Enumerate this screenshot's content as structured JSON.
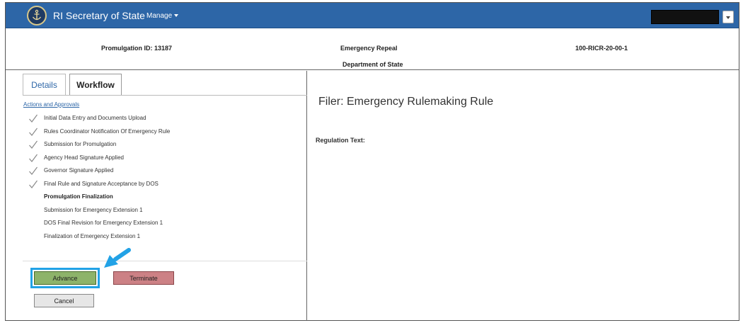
{
  "navbar": {
    "brand": "RI Secretary of State",
    "manage_label": "Manage",
    "accent": "#2d66a7"
  },
  "header": {
    "promulgation_id": "Promulgation ID: 13187",
    "type": "Emergency Repeal",
    "ricr": "100-RICR-20-00-1",
    "department": "Department of State"
  },
  "tabs": [
    {
      "label": "Details"
    },
    {
      "label": "Workflow"
    }
  ],
  "workflow": {
    "section_title": "Actions and Approvals",
    "steps": [
      {
        "label": "Initial Data Entry and Documents Upload",
        "status": "complete"
      },
      {
        "label": "Rules Coordinator Notification Of Emergency Rule",
        "status": "complete"
      },
      {
        "label": "Submission for Promulgation",
        "status": "complete"
      },
      {
        "label": "Agency Head Signature Applied",
        "status": "complete"
      },
      {
        "label": "Governor Signature Applied",
        "status": "complete"
      },
      {
        "label": "Final Rule and Signature Acceptance by DOS",
        "status": "complete"
      },
      {
        "label": "Promulgation Finalization",
        "status": "current"
      },
      {
        "label": "Submission for Emergency Extension 1",
        "status": "pending"
      },
      {
        "label": "DOS Final Revision for Emergency Extension 1",
        "status": "pending"
      },
      {
        "label": "Finalization of Emergency Extension 1",
        "status": "pending"
      }
    ]
  },
  "actions": {
    "advance_label": "Advance",
    "terminate_label": "Terminate",
    "cancel_label": "Cancel",
    "highlight_color": "#22a2e6"
  },
  "main": {
    "title": "Filer: Emergency Rulemaking Rule",
    "regulation_text_label": "Regulation Text:"
  }
}
